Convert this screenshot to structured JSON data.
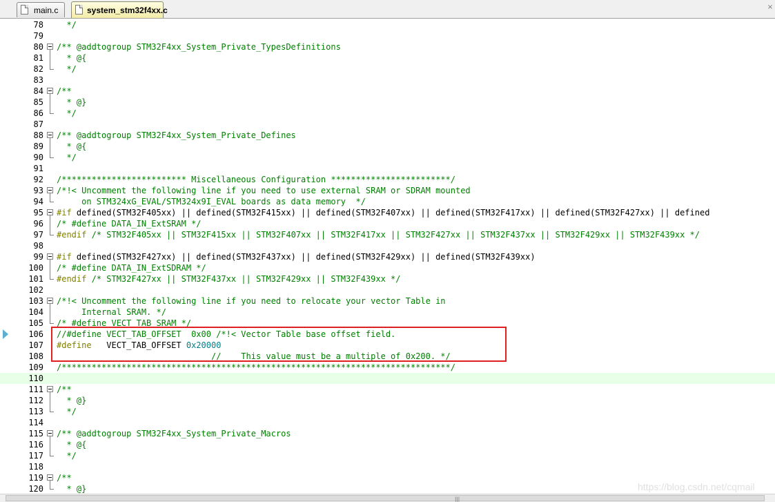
{
  "tabs": [
    {
      "label": "main.c",
      "active": false
    },
    {
      "label": "system_stm32f4xx.c",
      "active": true
    }
  ],
  "close_glyph": "×",
  "watermark": "https://blog.csdn.net/cqmail",
  "grip": "|||",
  "current_line": "106",
  "highlighted_line": "110",
  "lines": [
    {
      "n": "78",
      "spans": [
        [
          "c",
          "  */"
        ]
      ]
    },
    {
      "n": "79",
      "spans": []
    },
    {
      "n": "80",
      "spans": [
        [
          "c",
          "/** @addtogroup STM32F4xx_System_Private_TypesDefinitions"
        ]
      ]
    },
    {
      "n": "81",
      "spans": [
        [
          "c",
          "  * @{"
        ]
      ]
    },
    {
      "n": "82",
      "spans": [
        [
          "c",
          "  */"
        ]
      ]
    },
    {
      "n": "83",
      "spans": []
    },
    {
      "n": "84",
      "spans": [
        [
          "c",
          "/**"
        ]
      ]
    },
    {
      "n": "85",
      "spans": [
        [
          "c",
          "  * @}"
        ]
      ]
    },
    {
      "n": "86",
      "spans": [
        [
          "c",
          "  */"
        ]
      ]
    },
    {
      "n": "87",
      "spans": []
    },
    {
      "n": "88",
      "spans": [
        [
          "c",
          "/** @addtogroup STM32F4xx_System_Private_Defines"
        ]
      ]
    },
    {
      "n": "89",
      "spans": [
        [
          "c",
          "  * @{"
        ]
      ]
    },
    {
      "n": "90",
      "spans": [
        [
          "c",
          "  */"
        ]
      ]
    },
    {
      "n": "91",
      "spans": []
    },
    {
      "n": "92",
      "spans": [
        [
          "c",
          "/************************* Miscellaneous Configuration ************************/"
        ]
      ]
    },
    {
      "n": "93",
      "spans": [
        [
          "c",
          "/*!< Uncomment the following line if you need to use external SRAM or SDRAM mounted"
        ]
      ]
    },
    {
      "n": "94",
      "spans": [
        [
          "c",
          "     on STM324xG_EVAL/STM324x9I_EVAL boards as data memory  */"
        ]
      ]
    },
    {
      "n": "95",
      "spans": [
        [
          "p",
          "#if "
        ],
        [
          "t",
          "defined(STM32F405xx) || defined(STM32F415xx) || defined(STM32F407xx) || defined(STM32F417xx) || defined(STM32F427xx) || defined"
        ]
      ]
    },
    {
      "n": "96",
      "spans": [
        [
          "c",
          "/* #define DATA_IN_ExtSRAM */"
        ]
      ]
    },
    {
      "n": "97",
      "spans": [
        [
          "p",
          "#endif "
        ],
        [
          "c",
          "/* STM32F405xx || STM32F415xx || STM32F407xx || STM32F417xx || STM32F427xx || STM32F437xx || STM32F429xx || STM32F439xx */"
        ]
      ]
    },
    {
      "n": "98",
      "spans": []
    },
    {
      "n": "99",
      "spans": [
        [
          "p",
          "#if "
        ],
        [
          "t",
          "defined(STM32F427xx) || defined(STM32F437xx) || defined(STM32F429xx) || defined(STM32F439xx)"
        ]
      ]
    },
    {
      "n": "100",
      "spans": [
        [
          "c",
          "/* #define DATA_IN_ExtSDRAM */"
        ]
      ]
    },
    {
      "n": "101",
      "spans": [
        [
          "p",
          "#endif "
        ],
        [
          "c",
          "/* STM32F427xx || STM32F437xx || STM32F429xx || STM32F439xx */"
        ]
      ]
    },
    {
      "n": "102",
      "spans": []
    },
    {
      "n": "103",
      "spans": [
        [
          "c",
          "/*!< Uncomment the following line if you need to relocate your vector Table in"
        ]
      ]
    },
    {
      "n": "104",
      "spans": [
        [
          "c",
          "     Internal SRAM. */"
        ]
      ]
    },
    {
      "n": "105",
      "spans": [
        [
          "c",
          "/* #define VECT_TAB_SRAM */"
        ]
      ]
    },
    {
      "n": "106",
      "spans": [
        [
          "c",
          "//#define VECT_TAB_OFFSET  0x00 /*!< Vector Table base offset field."
        ]
      ]
    },
    {
      "n": "107",
      "spans": [
        [
          "p",
          "#define"
        ],
        [
          "t",
          "   VECT_TAB_OFFSET "
        ],
        [
          "n",
          "0x20000"
        ]
      ]
    },
    {
      "n": "108",
      "spans": [
        [
          "c",
          "                               //    This value must be a multiple of 0x200. */"
        ]
      ]
    },
    {
      "n": "109",
      "spans": [
        [
          "c",
          "/******************************************************************************/"
        ]
      ]
    },
    {
      "n": "110",
      "spans": []
    },
    {
      "n": "111",
      "spans": [
        [
          "c",
          "/**"
        ]
      ]
    },
    {
      "n": "112",
      "spans": [
        [
          "c",
          "  * @}"
        ]
      ]
    },
    {
      "n": "113",
      "spans": [
        [
          "c",
          "  */"
        ]
      ]
    },
    {
      "n": "114",
      "spans": []
    },
    {
      "n": "115",
      "spans": [
        [
          "c",
          "/** @addtogroup STM32F4xx_System_Private_Macros"
        ]
      ]
    },
    {
      "n": "116",
      "spans": [
        [
          "c",
          "  * @{"
        ]
      ]
    },
    {
      "n": "117",
      "spans": [
        [
          "c",
          "  */"
        ]
      ]
    },
    {
      "n": "118",
      "spans": []
    },
    {
      "n": "119",
      "spans": [
        [
          "c",
          "/**"
        ]
      ]
    },
    {
      "n": "120",
      "spans": [
        [
          "c",
          "  * @}"
        ]
      ]
    }
  ]
}
